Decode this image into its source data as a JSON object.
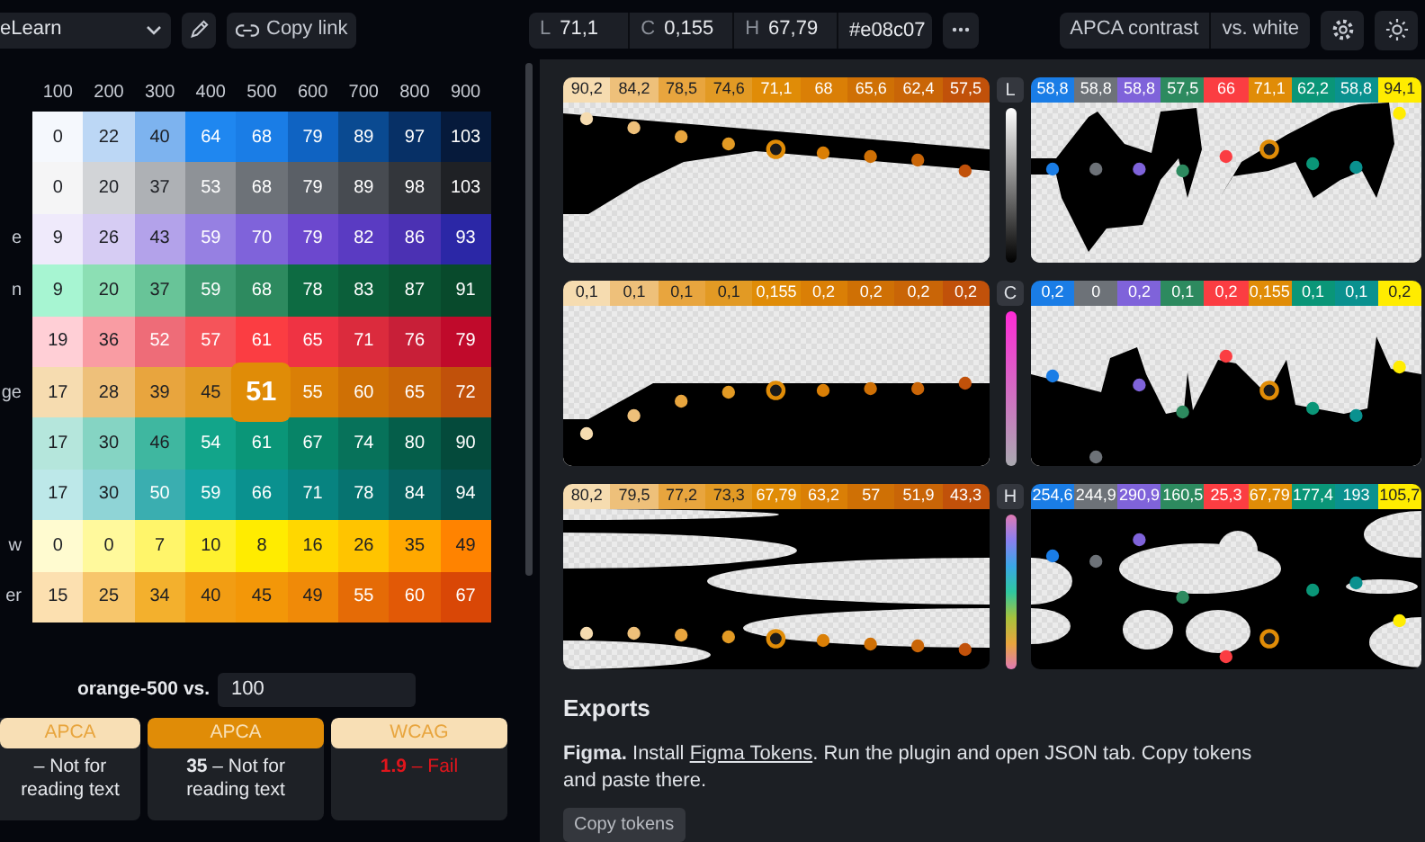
{
  "toolbar": {
    "palette": "eLearn",
    "copy_link": "Copy link",
    "fields": [
      {
        "label": "L",
        "value": "71,1"
      },
      {
        "label": "C",
        "value": "0,155"
      },
      {
        "label": "H",
        "value": "67,79"
      }
    ],
    "hex": "#e08c07",
    "contrast_mode": "APCA contrast",
    "contrast_target": "vs. white"
  },
  "grid": {
    "columns": [
      "100",
      "200",
      "300",
      "400",
      "500",
      "600",
      "700",
      "800",
      "900"
    ],
    "rows": [
      {
        "cells": [
          {
            "value": "0",
            "color": "#f5f8fd",
            "selected": false
          },
          {
            "value": "22",
            "color": "#bcd7f5",
            "selected": false
          },
          {
            "value": "40",
            "color": "#7db3ef",
            "selected": false
          },
          {
            "value": "64",
            "color": "#1f87f0",
            "selected": false
          },
          {
            "value": "68",
            "color": "#1a7de6",
            "selected": false
          },
          {
            "value": "79",
            "color": "#0f63c2",
            "selected": false
          },
          {
            "value": "89",
            "color": "#0a4a91",
            "selected": false
          },
          {
            "value": "97",
            "color": "#073066",
            "selected": false
          },
          {
            "value": "103",
            "color": "#061a3b",
            "selected": false
          }
        ]
      },
      {
        "cells": [
          {
            "value": "0",
            "color": "#f5f5f6",
            "selected": false
          },
          {
            "value": "20",
            "color": "#d2d4d7",
            "selected": false
          },
          {
            "value": "37",
            "color": "#aeb1b5",
            "selected": false
          },
          {
            "value": "53",
            "color": "#8e9297",
            "selected": false
          },
          {
            "value": "68",
            "color": "#6d7278",
            "selected": false
          },
          {
            "value": "79",
            "color": "#5a5f66",
            "selected": false
          },
          {
            "value": "89",
            "color": "#474b51",
            "selected": false
          },
          {
            "value": "98",
            "color": "#33363b",
            "selected": false
          },
          {
            "value": "103",
            "color": "#1f2125",
            "selected": false
          }
        ]
      },
      {
        "label": "e",
        "cells": [
          {
            "value": "9",
            "color": "#efeafb",
            "selected": false
          },
          {
            "value": "26",
            "color": "#d6ccf3",
            "selected": false
          },
          {
            "value": "43",
            "color": "#b3a2ea",
            "selected": false
          },
          {
            "value": "59",
            "color": "#9680e2",
            "selected": false
          },
          {
            "value": "70",
            "color": "#7f63da",
            "selected": false
          },
          {
            "value": "79",
            "color": "#6c48ce",
            "selected": false
          },
          {
            "value": "82",
            "color": "#5a3bc2",
            "selected": false
          },
          {
            "value": "86",
            "color": "#4b31b3",
            "selected": false
          },
          {
            "value": "93",
            "color": "#2b27a6",
            "selected": false
          }
        ]
      },
      {
        "label": "n",
        "cells": [
          {
            "value": "9",
            "color": "#a7f5d2",
            "selected": false
          },
          {
            "value": "20",
            "color": "#8cdfb4",
            "selected": false
          },
          {
            "value": "37",
            "color": "#68c498",
            "selected": false
          },
          {
            "value": "59",
            "color": "#3e9c72",
            "selected": false
          },
          {
            "value": "68",
            "color": "#2d8a5f",
            "selected": false
          },
          {
            "value": "78",
            "color": "#0d6b42",
            "selected": false
          },
          {
            "value": "83",
            "color": "#0b5f3a",
            "selected": false
          },
          {
            "value": "87",
            "color": "#0a5533",
            "selected": false
          },
          {
            "value": "91",
            "color": "#084a2c",
            "selected": false
          }
        ]
      },
      {
        "cells": [
          {
            "value": "19",
            "color": "#ffcfd6",
            "selected": false
          },
          {
            "value": "36",
            "color": "#f99ca3",
            "selected": false
          },
          {
            "value": "52",
            "color": "#ee6c78",
            "selected": false
          },
          {
            "value": "57",
            "color": "#f5545a",
            "selected": false
          },
          {
            "value": "61",
            "color": "#fb3d42",
            "selected": false
          },
          {
            "value": "65",
            "color": "#ef3343",
            "selected": false
          },
          {
            "value": "71",
            "color": "#db2b3d",
            "selected": false
          },
          {
            "value": "76",
            "color": "#c81f38",
            "selected": false
          },
          {
            "value": "79",
            "color": "#c00a2b",
            "selected": false
          }
        ]
      },
      {
        "label": "ge",
        "cells": [
          {
            "value": "17",
            "color": "#f6dcb0",
            "selected": false
          },
          {
            "value": "28",
            "color": "#eec07a",
            "selected": false
          },
          {
            "value": "39",
            "color": "#e8a53e",
            "selected": false
          },
          {
            "value": "45",
            "color": "#e29a24",
            "selected": false
          },
          {
            "value": "51",
            "color": "#e08c07",
            "selected": true
          },
          {
            "value": "55",
            "color": "#da7f06",
            "selected": false
          },
          {
            "value": "60",
            "color": "#cf7005",
            "selected": false
          },
          {
            "value": "65",
            "color": "#c96507",
            "selected": false
          },
          {
            "value": "72",
            "color": "#c1510a",
            "selected": false
          }
        ]
      },
      {
        "cells": [
          {
            "value": "17",
            "color": "#b5e6dc",
            "selected": false
          },
          {
            "value": "30",
            "color": "#85d4c3",
            "selected": false
          },
          {
            "value": "46",
            "color": "#3fb7a0",
            "selected": false
          },
          {
            "value": "54",
            "color": "#12a58a",
            "selected": false
          },
          {
            "value": "61",
            "color": "#0a9678",
            "selected": false
          },
          {
            "value": "67",
            "color": "#078467",
            "selected": false
          },
          {
            "value": "74",
            "color": "#07725a",
            "selected": false
          },
          {
            "value": "80",
            "color": "#055e4a",
            "selected": false
          },
          {
            "value": "90",
            "color": "#044a3b",
            "selected": false
          }
        ]
      },
      {
        "cells": [
          {
            "value": "17",
            "color": "#bde8e9",
            "selected": false
          },
          {
            "value": "30",
            "color": "#8fd4d6",
            "selected": false
          },
          {
            "value": "50",
            "color": "#3aaeb0",
            "selected": false
          },
          {
            "value": "59",
            "color": "#14a3a2",
            "selected": false
          },
          {
            "value": "66",
            "color": "#0a918f",
            "selected": false
          },
          {
            "value": "71",
            "color": "#078380",
            "selected": false
          },
          {
            "value": "78",
            "color": "#067370",
            "selected": false
          },
          {
            "value": "84",
            "color": "#066260",
            "selected": false
          },
          {
            "value": "94",
            "color": "#05504e",
            "selected": false
          }
        ]
      },
      {
        "label": "w",
        "cells": [
          {
            "value": "0",
            "color": "#fffbd0",
            "selected": false
          },
          {
            "value": "0",
            "color": "#fff99c",
            "selected": false
          },
          {
            "value": "7",
            "color": "#fff56a",
            "selected": false
          },
          {
            "value": "10",
            "color": "#fff12f",
            "selected": false
          },
          {
            "value": "8",
            "color": "#ffec00",
            "selected": false
          },
          {
            "value": "16",
            "color": "#ffd700",
            "selected": false
          },
          {
            "value": "26",
            "color": "#ffc400",
            "selected": false
          },
          {
            "value": "35",
            "color": "#ffa800",
            "selected": false
          },
          {
            "value": "49",
            "color": "#ff8300",
            "selected": false
          }
        ]
      },
      {
        "label": "er",
        "cells": [
          {
            "value": "15",
            "color": "#fce0b0",
            "selected": false
          },
          {
            "value": "25",
            "color": "#f7c66c",
            "selected": false
          },
          {
            "value": "34",
            "color": "#f3b02d",
            "selected": false
          },
          {
            "value": "40",
            "color": "#f29d13",
            "selected": false
          },
          {
            "value": "45",
            "color": "#f39708",
            "selected": false
          },
          {
            "value": "49",
            "color": "#f08a08",
            "selected": false
          },
          {
            "value": "55",
            "color": "#e56b06",
            "selected": false
          },
          {
            "value": "60",
            "color": "#e25906",
            "selected": false
          },
          {
            "value": "67",
            "color": "#d94706",
            "selected": false
          }
        ]
      }
    ]
  },
  "comparison": {
    "label": "orange-500 vs.",
    "value": "100",
    "cards": [
      {
        "title": "APCA",
        "result": "– Not for reading text",
        "selected": false,
        "failed": false
      },
      {
        "title": "APCA",
        "result": "**35** – Not for reading text",
        "selected": true,
        "failed": false
      },
      {
        "title": "WCAG",
        "result": "**1.9** – Fail",
        "selected": false,
        "failed": true
      }
    ]
  },
  "charts": [
    {
      "axis": "L",
      "left": [
        {
          "value": "90,2",
          "color": "#f6dcb0",
          "selected": false
        },
        {
          "value": "84,2",
          "color": "#eec07a",
          "selected": false
        },
        {
          "value": "78,5",
          "color": "#e8a53e",
          "selected": false
        },
        {
          "value": "74,6",
          "color": "#e29a24",
          "selected": false
        },
        {
          "value": "71,1",
          "color": "#e08c07",
          "selected": true
        },
        {
          "value": "68",
          "color": "#da7f06",
          "selected": false
        },
        {
          "value": "65,6",
          "color": "#cf7005",
          "selected": false
        },
        {
          "value": "62,4",
          "color": "#c96507",
          "selected": false
        },
        {
          "value": "57,5",
          "color": "#c1510a",
          "selected": false
        }
      ],
      "right": [
        {
          "value": "58,8",
          "color": "#1a7de6",
          "selected": false
        },
        {
          "value": "58,8",
          "color": "#6d7278",
          "selected": false
        },
        {
          "value": "58,8",
          "color": "#7f63da",
          "selected": false
        },
        {
          "value": "57,5",
          "color": "#2d8a5f",
          "selected": false
        },
        {
          "value": "66",
          "color": "#fb3d42",
          "selected": false
        },
        {
          "value": "71,1",
          "color": "#e08c07",
          "selected": true
        },
        {
          "value": "62,2",
          "color": "#0a9678",
          "selected": false
        },
        {
          "value": "58,8",
          "color": "#0a918f",
          "selected": false
        },
        {
          "value": "94,1",
          "color": "#ffec00",
          "selected": false
        }
      ]
    },
    {
      "axis": "C",
      "left": [
        {
          "value": "0,1",
          "color": "#f6dcb0",
          "selected": false
        },
        {
          "value": "0,1",
          "color": "#eec07a",
          "selected": false
        },
        {
          "value": "0,1",
          "color": "#e8a53e",
          "selected": false
        },
        {
          "value": "0,1",
          "color": "#e29a24",
          "selected": false
        },
        {
          "value": "0,155",
          "color": "#e08c07",
          "selected": true
        },
        {
          "value": "0,2",
          "color": "#da7f06",
          "selected": false
        },
        {
          "value": "0,2",
          "color": "#cf7005",
          "selected": false
        },
        {
          "value": "0,2",
          "color": "#c96507",
          "selected": false
        },
        {
          "value": "0,2",
          "color": "#c1510a",
          "selected": false
        }
      ],
      "right": [
        {
          "value": "0,2",
          "color": "#1a7de6",
          "selected": false
        },
        {
          "value": "0",
          "color": "#6d7278",
          "selected": false
        },
        {
          "value": "0,2",
          "color": "#7f63da",
          "selected": false
        },
        {
          "value": "0,1",
          "color": "#2d8a5f",
          "selected": false
        },
        {
          "value": "0,2",
          "color": "#fb3d42",
          "selected": false
        },
        {
          "value": "0,155",
          "color": "#e08c07",
          "selected": true
        },
        {
          "value": "0,1",
          "color": "#0a9678",
          "selected": false
        },
        {
          "value": "0,1",
          "color": "#0a918f",
          "selected": false
        },
        {
          "value": "0,2",
          "color": "#ffec00",
          "selected": false
        }
      ]
    },
    {
      "axis": "H",
      "left": [
        {
          "value": "80,2",
          "color": "#f6dcb0",
          "selected": false
        },
        {
          "value": "79,5",
          "color": "#eec07a",
          "selected": false
        },
        {
          "value": "77,2",
          "color": "#e8a53e",
          "selected": false
        },
        {
          "value": "73,3",
          "color": "#e29a24",
          "selected": false
        },
        {
          "value": "67,79",
          "color": "#e08c07",
          "selected": true
        },
        {
          "value": "63,2",
          "color": "#da7f06",
          "selected": false
        },
        {
          "value": "57",
          "color": "#cf7005",
          "selected": false
        },
        {
          "value": "51,9",
          "color": "#c96507",
          "selected": false
        },
        {
          "value": "43,3",
          "color": "#c1510a",
          "selected": false
        }
      ],
      "right": [
        {
          "value": "254,6",
          "color": "#1a7de6",
          "selected": false
        },
        {
          "value": "244,9",
          "color": "#6d7278",
          "selected": false
        },
        {
          "value": "290,9",
          "color": "#7f63da",
          "selected": false
        },
        {
          "value": "160,5",
          "color": "#2d8a5f",
          "selected": false
        },
        {
          "value": "25,3",
          "color": "#fb3d42",
          "selected": false
        },
        {
          "value": "67,79",
          "color": "#e08c07",
          "selected": true
        },
        {
          "value": "177,4",
          "color": "#0a9678",
          "selected": false
        },
        {
          "value": "193",
          "color": "#0a918f",
          "selected": false
        },
        {
          "value": "105,7",
          "color": "#ffec00",
          "selected": false
        }
      ]
    }
  ],
  "exports": {
    "title": "Exports",
    "lead": "**Figma.** Install ",
    "link": "Figma Tokens",
    "rest": ". Run the plugin and open JSON tab. Copy tokens and paste there.",
    "button": "Copy tokens"
  }
}
